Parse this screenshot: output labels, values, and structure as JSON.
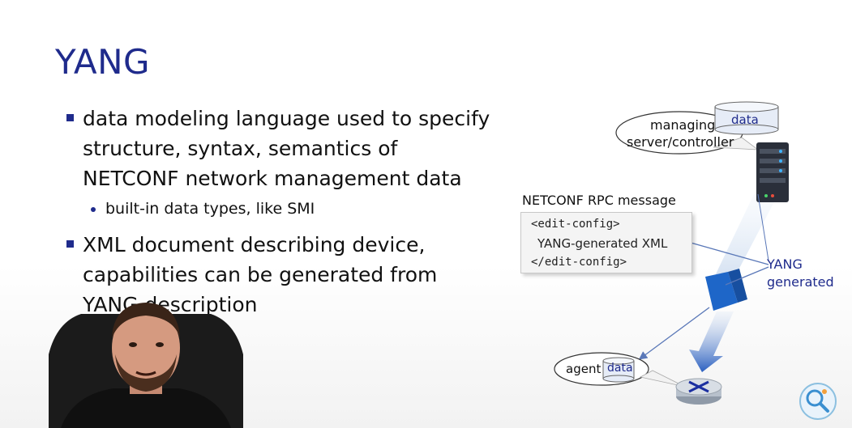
{
  "slide": {
    "title": "YANG",
    "bullets": [
      {
        "text": "data modeling language used to specify\nstructure, syntax, semantics of\nNETCONF network management data"
      },
      {
        "text": "XML document describing device,\ncapabilities can be generated from\nYANG description"
      }
    ],
    "sub_bullet": "built-in data types, like SMI"
  },
  "diagram": {
    "managing_label_line1": "managing",
    "managing_label_line2": "server/controller",
    "data_label_top": "data",
    "rpc_label": "NETCONF RPC message",
    "code_lines": [
      "<edit-config>",
      "YANG-generated XML",
      "</edit-config>"
    ],
    "yang_generated_line1": "YANG",
    "yang_generated_line2": "generated",
    "agent_label": "agent",
    "data_label_bottom": "data"
  },
  "colors": {
    "title": "#1f2b8c",
    "accent": "#1f2b8c",
    "server": "#2a2f3a",
    "firewall": "#1e66c8",
    "router": "#1b2fa0"
  },
  "icons": {
    "server": "server-rack-icon",
    "database": "database-cylinder-icon",
    "router": "router-icon",
    "firewall": "yang-model-block-icon",
    "logo": "channel-logo-icon"
  }
}
